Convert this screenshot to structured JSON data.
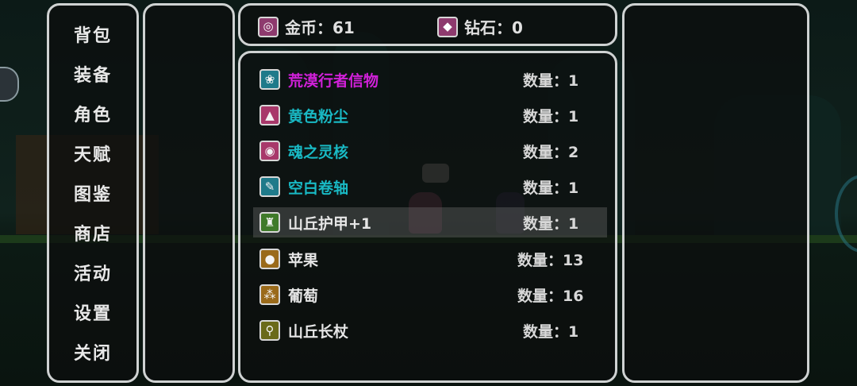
{
  "currency": {
    "gold_label": "金币：61",
    "diamond_label": "钻石：0"
  },
  "menu": {
    "items": [
      {
        "label": "背包"
      },
      {
        "label": "装备"
      },
      {
        "label": "角色"
      },
      {
        "label": "天赋"
      },
      {
        "label": "图鉴"
      },
      {
        "label": "商店"
      },
      {
        "label": "活动"
      },
      {
        "label": "设置"
      },
      {
        "label": "关闭"
      }
    ]
  },
  "inventory": {
    "items": [
      {
        "name": "荒漠行者信物",
        "qty": "数量：1",
        "color": "#d020d8",
        "icon": "desert-token-icon",
        "icon_bg": "#1f7a8a",
        "glyph": "❀"
      },
      {
        "name": "黄色粉尘",
        "qty": "数量：1",
        "color": "#19b9c4",
        "icon": "dust-icon",
        "icon_bg": "#a8386a",
        "glyph": "▲"
      },
      {
        "name": "魂之灵核",
        "qty": "数量：2",
        "color": "#19b9c4",
        "icon": "soul-core-icon",
        "icon_bg": "#a8386a",
        "glyph": "◉"
      },
      {
        "name": "空白卷轴",
        "qty": "数量：1",
        "color": "#19b9c4",
        "icon": "scroll-icon",
        "icon_bg": "#1f7a8a",
        "glyph": "✎"
      },
      {
        "name": "山丘护甲+1",
        "qty": "数量：1",
        "color": "#e6e6e6",
        "icon": "armor-icon",
        "icon_bg": "#3f7a2a",
        "glyph": "♜"
      },
      {
        "name": "苹果",
        "qty": "数量：13",
        "color": "#e6e6e6",
        "icon": "apple-icon",
        "icon_bg": "#9a6a1a",
        "glyph": "●"
      },
      {
        "name": "葡萄",
        "qty": "数量：16",
        "color": "#e6e6e6",
        "icon": "grape-icon",
        "icon_bg": "#9a6a1a",
        "glyph": "⁂"
      },
      {
        "name": "山丘长杖",
        "qty": "数量：1",
        "color": "#e6e6e6",
        "icon": "staff-icon",
        "icon_bg": "#6a6a1a",
        "glyph": "⚲"
      }
    ]
  }
}
